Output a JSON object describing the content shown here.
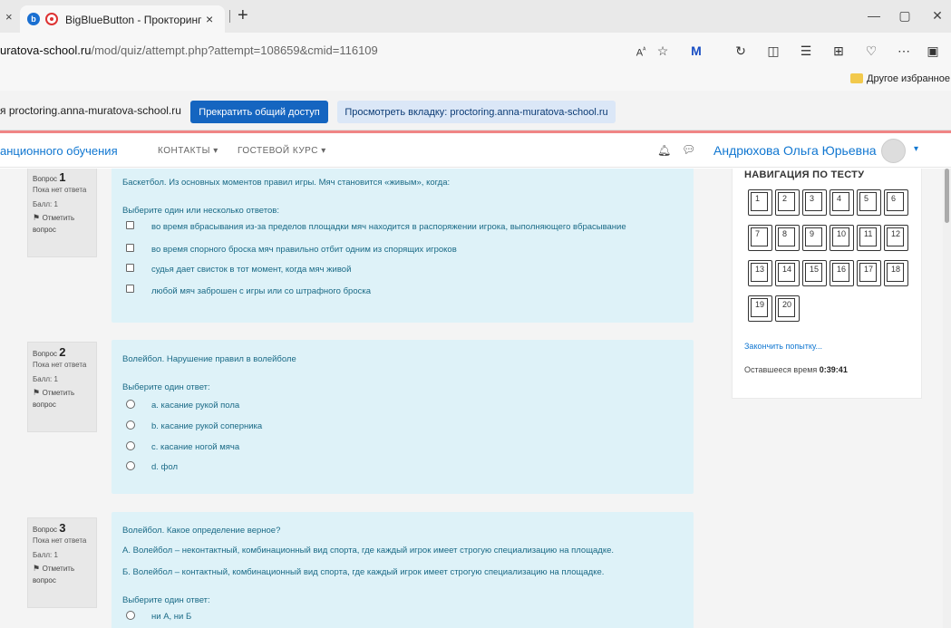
{
  "browser": {
    "prev_tab_close": "×",
    "tab_title": "BigBlueButton - Прокторинг",
    "tab_close": "×",
    "new_tab": "+",
    "url_host": "uratova-school.ru",
    "url_path": "/mod/quiz/attempt.php?attempt=108659&cmid=116109",
    "favorites_label": "Другое избранное"
  },
  "share": {
    "text": "я proctoring.anna-muratova-school.ru",
    "stop_label": "Прекратить общий доступ",
    "view_label": "Просмотреть вкладку: proctoring.anna-muratova-school.ru"
  },
  "nav": {
    "brand": "анционного обучения",
    "links": [
      "КОНТАКТЫ ▾",
      "ГОСТЕВОЙ КУРС ▾"
    ],
    "user": "Андрюхова Ольга Юрьевна",
    "caret": "▾"
  },
  "questions": [
    {
      "label": "Вопрос",
      "number": "1",
      "status": "Пока нет ответа",
      "points": "Балл: 1",
      "flag": "Отметить вопрос",
      "text": "Баскетбол. Из основных моментов правил игры. Мяч становится «живым», когда:",
      "prompt": "Выберите один или несколько ответов:",
      "options": [
        "во время вбрасывания из-за пределов площадки мяч находится в распоряжении игрока, выполняющего вбрасывание",
        "во время спорного броска мяч правильно отбит одним из спорящих игроков",
        "судья дает свисток в тот момент, когда мяч живой",
        "любой мяч заброшен с игры или со штрафного броска"
      ]
    },
    {
      "label": "Вопрос",
      "number": "2",
      "status": "Пока нет ответа",
      "points": "Балл: 1",
      "flag": "Отметить вопрос",
      "text": "Волейбол. Нарушение правил в волейболе",
      "prompt": "Выберите один ответ:",
      "options": [
        "a. касание рукой пола",
        "b. касание рукой соперника",
        "c. касание ногой мяча",
        "d. фол"
      ]
    },
    {
      "label": "Вопрос",
      "number": "3",
      "status": "Пока нет ответа",
      "points": "Балл: 1",
      "flag": "Отметить вопрос",
      "text": "Волейбол. Какое определение верное?",
      "text_a": "А. Волейбол – неконтактный, комбинационный вид спорта, где каждый игрок имеет строгую специализацию на площадке.",
      "text_b": "Б. Волейбол – контактный, комбинационный вид спорта, где каждый игрок имеет строгую специализацию на площадке.",
      "prompt": "Выберите один ответ:",
      "options": [
        "ни А, ни Б"
      ]
    }
  ],
  "quiz_nav": {
    "title": "НАВИГАЦИЯ ПО ТЕСТУ",
    "buttons": [
      "1",
      "2",
      "3",
      "4",
      "5",
      "6",
      "7",
      "8",
      "9",
      "10",
      "11",
      "12",
      "13",
      "14",
      "15",
      "16",
      "17",
      "18",
      "19",
      "20"
    ],
    "finish": "Закончить попытку...",
    "timer_label": "Оставшееся время",
    "timer_value": "0:39:41"
  }
}
